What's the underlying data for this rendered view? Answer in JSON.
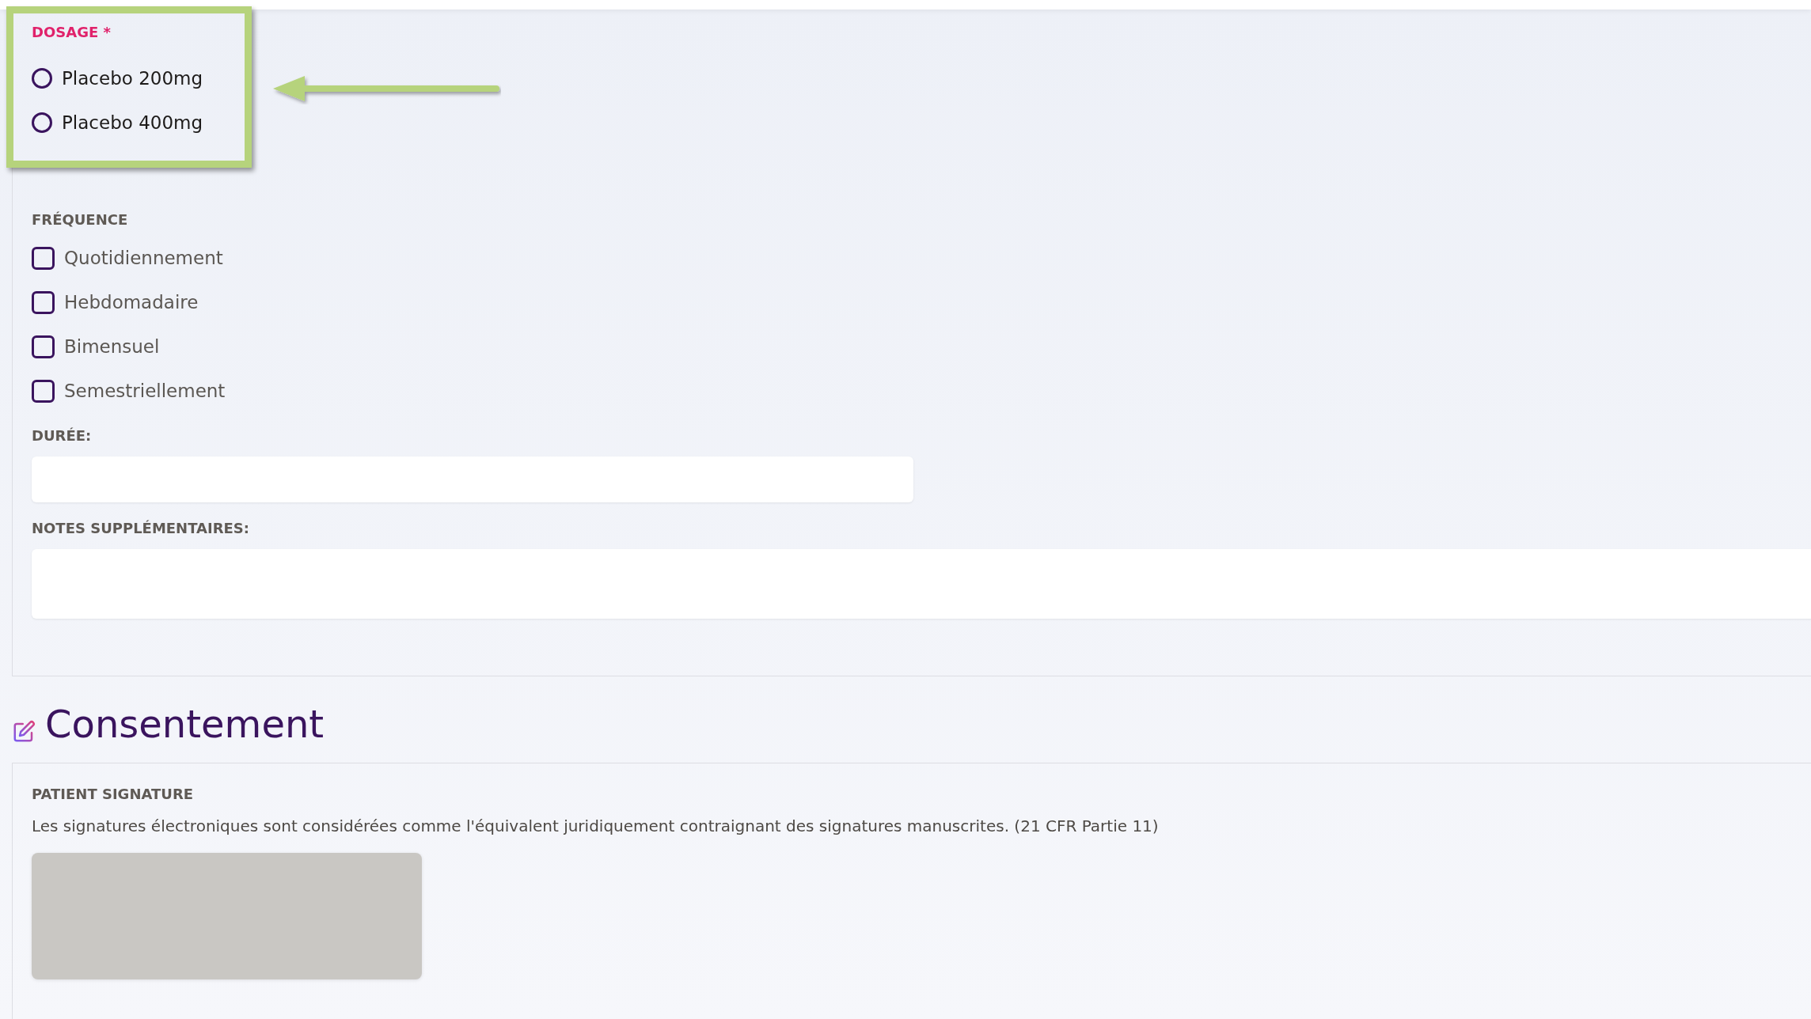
{
  "dosage": {
    "label": "DOSAGE",
    "required_mark": "*",
    "options": [
      {
        "label": "Placebo 200mg",
        "selected": false
      },
      {
        "label": "Placebo 400mg",
        "selected": false
      }
    ]
  },
  "frequency": {
    "label": "FRÉQUENCE",
    "options": [
      {
        "label": "Quotidiennement",
        "checked": false
      },
      {
        "label": "Hebdomadaire",
        "checked": false
      },
      {
        "label": "Bimensuel",
        "checked": false
      },
      {
        "label": "Semestriellement",
        "checked": false
      }
    ]
  },
  "duration": {
    "label": "DURÉE:"
  },
  "notes": {
    "label": "NOTES SUPPLÉMENTAIRES:"
  },
  "consent": {
    "title": "Consentement",
    "signature": {
      "label": "PATIENT SIGNATURE",
      "note": "Les signatures électroniques sont considérées comme l'équivalent juridiquement contraignant des signatures manuscrites. (21 CFR Partie 11)"
    }
  }
}
